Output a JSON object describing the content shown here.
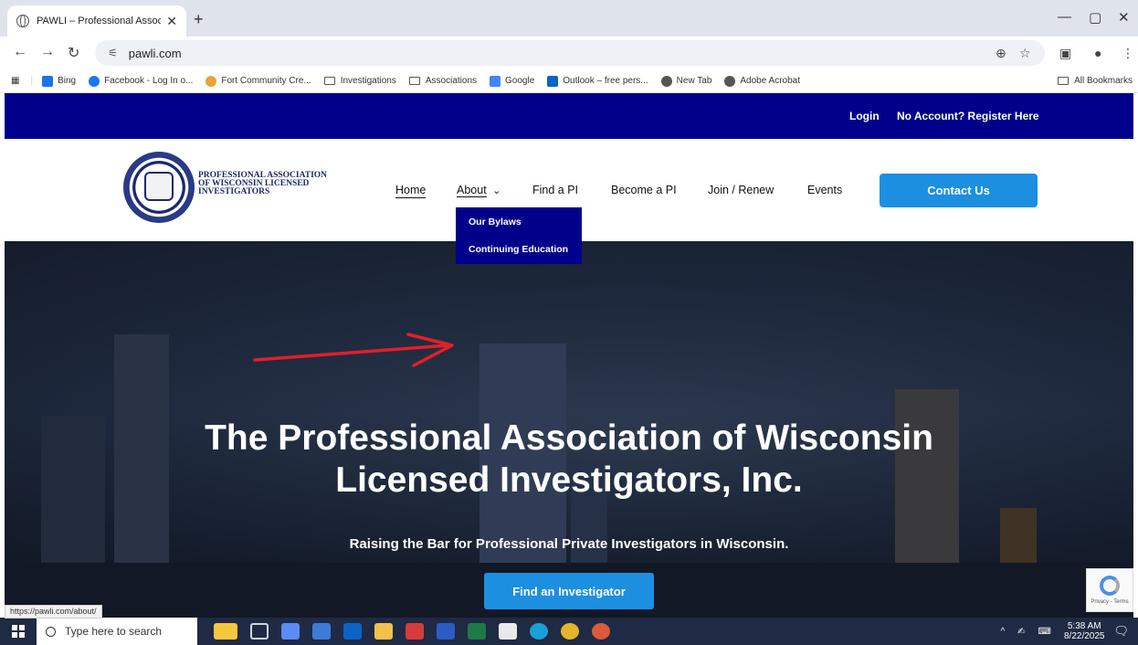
{
  "browser": {
    "tab_title": "PAWLI – Professional Associatio",
    "tab_close": "✕",
    "new_tab": "+",
    "url": "pawli.com",
    "status_url": "https://pawli.com/about/",
    "bookmarks": [
      {
        "label": "Bing",
        "icon": "bing-search-icon",
        "color": "#1a73e8"
      },
      {
        "label": "Facebook - Log In o...",
        "icon": "facebook-icon",
        "color": "#1877f2"
      },
      {
        "label": "Fort Community Cre...",
        "icon": "fort-community-icon",
        "color": "#e8a33d"
      },
      {
        "label": "Investigations",
        "icon": "folder-icon",
        "color": ""
      },
      {
        "label": "Associations",
        "icon": "folder-icon",
        "color": ""
      },
      {
        "label": "Google",
        "icon": "google-icon",
        "color": "#4285f4"
      },
      {
        "label": "Outlook – free pers...",
        "icon": "outlook-icon",
        "color": "#0a64c8"
      },
      {
        "label": "New Tab",
        "icon": "globe-icon",
        "color": "#555555"
      },
      {
        "label": "Adobe Acrobat",
        "icon": "globe-icon",
        "color": "#555555"
      }
    ],
    "all_bookmarks": "All Bookmarks"
  },
  "site": {
    "topbar": {
      "login": "Login",
      "register": "No Account? Register Here"
    },
    "org_name_lines": [
      "PROFESSIONAL ASSOCIATION",
      "OF WISCONSIN LICENSED",
      "INVESTIGATORS"
    ],
    "nav": {
      "home": "Home",
      "about": "About",
      "about_chevron": "⌄",
      "find_pi": "Find a PI",
      "become_pi": "Become a PI",
      "join_renew": "Join / Renew",
      "events": "Events",
      "contact": "Contact Us"
    },
    "dropdown": {
      "bylaws": "Our Bylaws",
      "continuing_ed": "Continuing Education"
    },
    "hero": {
      "title_line1": "The Professional Association of Wisconsin",
      "title_line2": "Licensed Investigators, Inc.",
      "subtitle": "Raising the Bar for Professional Private Investigators in Wisconsin.",
      "cta": "Find an Investigator"
    },
    "recaptcha": "Privacy - Terms"
  },
  "taskbar": {
    "search_placeholder": "Type here to search",
    "time": "5:38 AM",
    "date": "8/22/2025"
  },
  "colors": {
    "navy": "#00008b",
    "accent_blue": "#1c8fe0",
    "annotation_red": "#e0202a"
  }
}
